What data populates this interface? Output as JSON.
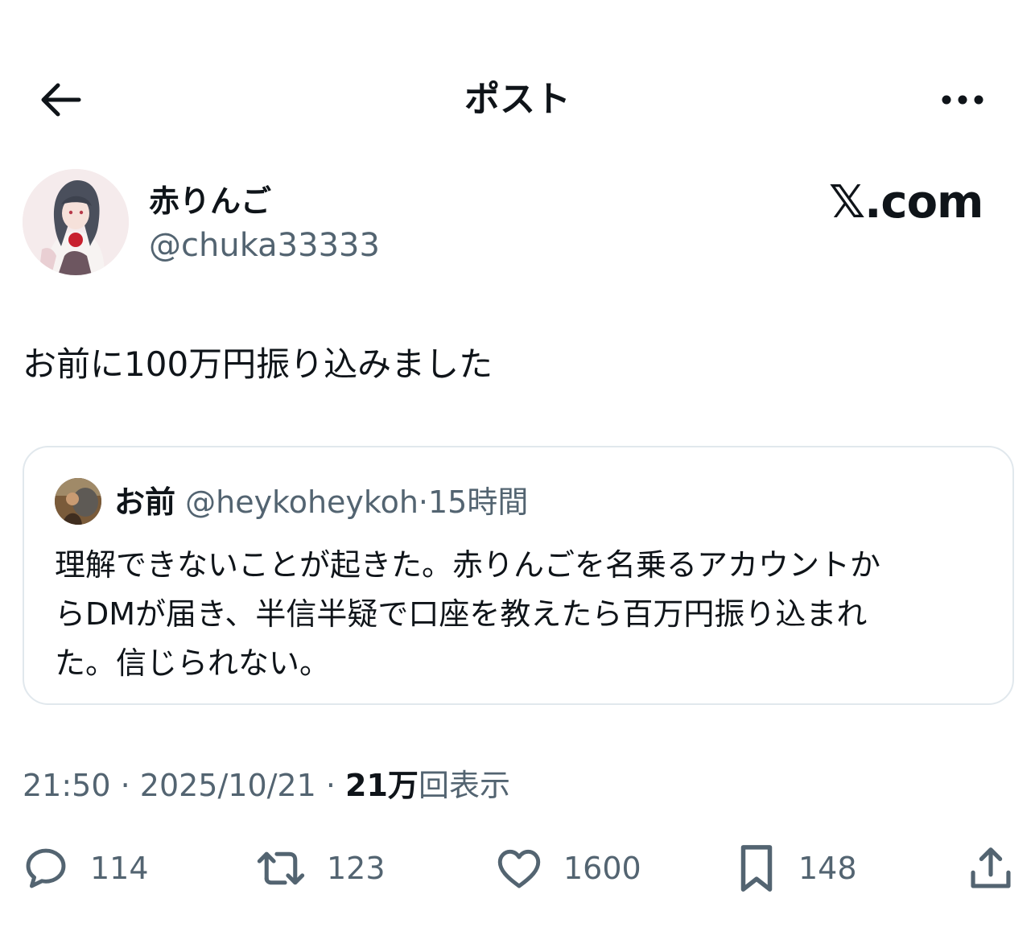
{
  "header": {
    "title": "ポスト"
  },
  "author": {
    "name": "赤りんご",
    "handle": "@chuka33333"
  },
  "brand": {
    "label": "𝕏.com"
  },
  "tweet": {
    "text": "お前に100万円振り込みました"
  },
  "quote": {
    "name": "お前",
    "handle": "@heykoheykoh",
    "dot": "·",
    "time": "15時間",
    "text_line1": "理解できないことが起きた。赤りんごを名乗るアカウントか",
    "text_line2": "らDMが届き、半信半疑で口座を教えたら百万円振り込まれ",
    "text_line3": "た。信じられない。"
  },
  "meta": {
    "time": "21:50",
    "sep1": " · ",
    "date": "2025/10/21",
    "sep2": " · ",
    "views_count": "21万",
    "views_label": "回表示"
  },
  "actions": {
    "reply_count": "114",
    "repost_count": "123",
    "like_count": "1600",
    "bookmark_count": "148"
  },
  "icons": {
    "back": "back-arrow-icon",
    "more": "more-icon",
    "reply": "reply-icon",
    "repost": "repost-icon",
    "like": "heart-icon",
    "bookmark": "bookmark-icon",
    "share": "share-icon"
  },
  "colors": {
    "text": "#0f1419",
    "secondary": "#536471",
    "border": "#e1e8ed"
  }
}
